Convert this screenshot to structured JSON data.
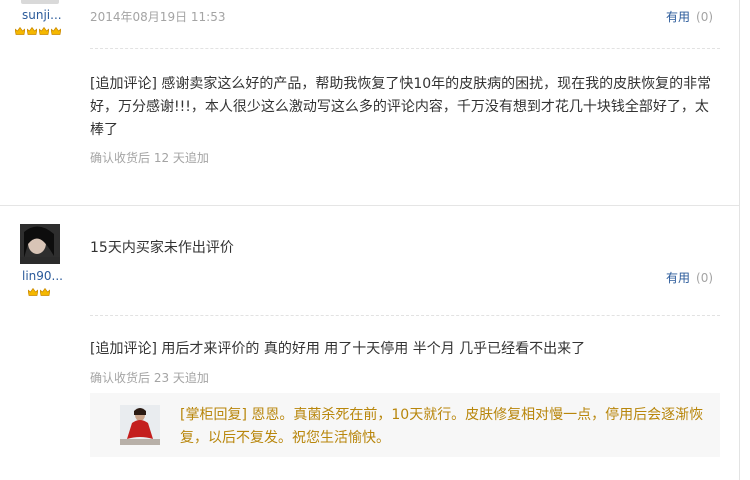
{
  "reviews": [
    {
      "username": "sunji...",
      "crown_count": 4,
      "date": "2014年08月19日 11:53",
      "useful_label": "有用",
      "useful_count": "(0)",
      "append": {
        "text": "[追加评论] 感谢卖家这么好的产品，帮助我恢复了快10年的皮肤病的困扰，现在我的皮肤恢复的非常好，万分感谢!!!，本人很少这么激动写这么多的评论内容，千万没有想到才花几十块钱全部好了，太棒了",
        "meta": "确认收货后 12 天追加"
      }
    },
    {
      "username": "lin90...",
      "crown_count": 2,
      "content": "15天内买家未作出评价",
      "useful_label": "有用",
      "useful_count": "(0)",
      "append": {
        "text": "[追加评论] 用后才来评价的 真的好用 用了十天停用 半个月 几乎已经看不出来了",
        "meta": "确认收货后 23 天追加"
      },
      "reply": {
        "text": "[掌柜回复] 恩恩。真菌杀死在前，10天就行。皮肤修复相对慢一点，停用后会逐渐恢复，以后不复发。祝您生活愉快。"
      }
    }
  ],
  "colors": {
    "link": "#2a5a9a",
    "muted": "#a4a4a4",
    "reply_text": "#b8860b",
    "reply_bg": "#f7f7f7",
    "crown": "#f5b800"
  },
  "icons": {
    "crown": "crown-icon",
    "avatar": "user-avatar"
  }
}
